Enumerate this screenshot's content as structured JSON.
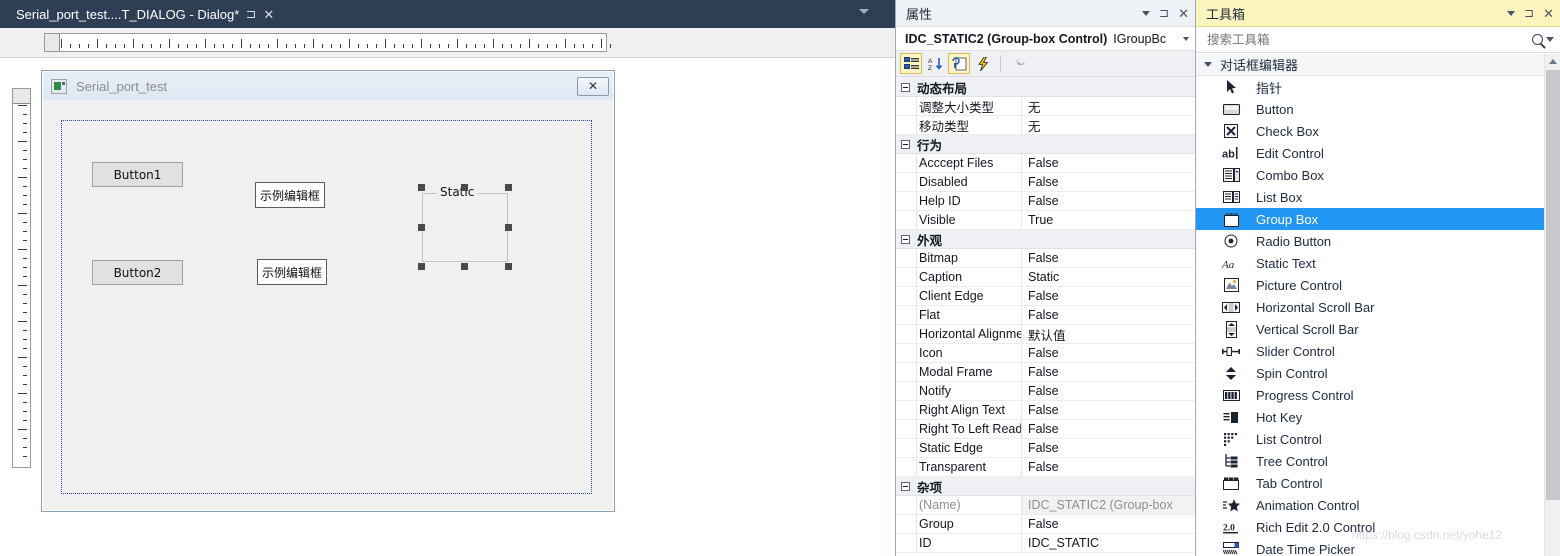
{
  "editor": {
    "tab": {
      "title": "Serial_port_test....T_DIALOG - Dialog*",
      "pin_icon": "⊐",
      "close_icon": "✕",
      "menu_icon": "chevron-down-icon"
    },
    "dialog": {
      "caption": "Serial_port_test",
      "close_label": "✕",
      "controls": [
        {
          "kind": "button",
          "label": "Button1"
        },
        {
          "kind": "button",
          "label": "Button2"
        },
        {
          "kind": "edit",
          "label": "示例编辑框"
        },
        {
          "kind": "edit",
          "label": "示例编辑框"
        },
        {
          "kind": "groupbox",
          "label": "Static",
          "selected": true
        }
      ]
    }
  },
  "properties": {
    "panel_title": "属性",
    "object_name": "IDC_STATIC2 (Group-box Control)",
    "object_type": "IGroupBc",
    "toolbar": [
      {
        "name": "categorized-view",
        "active": true
      },
      {
        "name": "alphabetical-sort",
        "active": false
      },
      {
        "name": "property-pages",
        "active": true
      },
      {
        "name": "events",
        "active": false
      },
      {
        "name": "messages",
        "active": false
      }
    ],
    "groups": [
      {
        "label": "动态布局",
        "rows": [
          {
            "name": "调整大小类型",
            "value": "无"
          },
          {
            "name": "移动类型",
            "value": "无"
          }
        ]
      },
      {
        "label": "行为",
        "rows": [
          {
            "name": "Acccept Files",
            "value": "False"
          },
          {
            "name": "Disabled",
            "value": "False"
          },
          {
            "name": "Help ID",
            "value": "False"
          },
          {
            "name": "Visible",
            "value": "True"
          }
        ]
      },
      {
        "label": "外观",
        "rows": [
          {
            "name": "Bitmap",
            "value": "False"
          },
          {
            "name": "Caption",
            "value": "Static"
          },
          {
            "name": "Client Edge",
            "value": "False"
          },
          {
            "name": "Flat",
            "value": "False"
          },
          {
            "name": "Horizontal Alignment",
            "value": "默认值"
          },
          {
            "name": "Icon",
            "value": "False"
          },
          {
            "name": "Modal Frame",
            "value": "False"
          },
          {
            "name": "Notify",
            "value": "False"
          },
          {
            "name": "Right Align Text",
            "value": "False"
          },
          {
            "name": "Right To Left Reading",
            "value": "False"
          },
          {
            "name": "Static Edge",
            "value": "False"
          },
          {
            "name": "Transparent",
            "value": "False"
          }
        ]
      },
      {
        "label": "杂项",
        "rows": [
          {
            "name": "(Name)",
            "value": "IDC_STATIC2 (Group-box",
            "readonly": true
          },
          {
            "name": "Group",
            "value": "False"
          },
          {
            "name": "ID",
            "value": "IDC_STATIC"
          }
        ]
      }
    ]
  },
  "toolbox": {
    "panel_title": "工具箱",
    "search_placeholder": "搜索工具箱",
    "search_value": "",
    "group_label": "对话框编辑器",
    "items": [
      {
        "label": "指针",
        "icon": "pointer-icon",
        "selected": false
      },
      {
        "label": "Button",
        "icon": "button-icon",
        "selected": false
      },
      {
        "label": "Check Box",
        "icon": "check-box-icon",
        "selected": false
      },
      {
        "label": "Edit Control",
        "icon": "edit-control-icon",
        "selected": false
      },
      {
        "label": "Combo Box",
        "icon": "combo-box-icon",
        "selected": false
      },
      {
        "label": "List Box",
        "icon": "list-box-icon",
        "selected": false
      },
      {
        "label": "Group Box",
        "icon": "group-box-icon",
        "selected": true
      },
      {
        "label": "Radio Button",
        "icon": "radio-button-icon",
        "selected": false
      },
      {
        "label": "Static Text",
        "icon": "static-text-icon",
        "selected": false
      },
      {
        "label": "Picture Control",
        "icon": "picture-control-icon",
        "selected": false
      },
      {
        "label": "Horizontal Scroll Bar",
        "icon": "horizontal-scroll-bar-icon",
        "selected": false
      },
      {
        "label": "Vertical Scroll Bar",
        "icon": "vertical-scroll-bar-icon",
        "selected": false
      },
      {
        "label": "Slider Control",
        "icon": "slider-control-icon",
        "selected": false
      },
      {
        "label": "Spin Control",
        "icon": "spin-control-icon",
        "selected": false
      },
      {
        "label": "Progress Control",
        "icon": "progress-control-icon",
        "selected": false
      },
      {
        "label": "Hot Key",
        "icon": "hot-key-icon",
        "selected": false
      },
      {
        "label": "List Control",
        "icon": "list-control-icon",
        "selected": false
      },
      {
        "label": "Tree Control",
        "icon": "tree-control-icon",
        "selected": false
      },
      {
        "label": "Tab Control",
        "icon": "tab-control-icon",
        "selected": false
      },
      {
        "label": "Animation Control",
        "icon": "animation-control-icon",
        "selected": false
      },
      {
        "label": "Rich Edit 2.0 Control",
        "icon": "rich-edit-icon",
        "selected": false
      },
      {
        "label": "Date Time Picker",
        "icon": "date-time-picker-icon",
        "selected": false
      }
    ]
  },
  "watermark": {
    "text": "https://blog.csdn.net/yohe12"
  },
  "colors": {
    "tab_bar": "#2d3e55",
    "toolbox_title": "#fcf3bd",
    "selection": "#2196f3",
    "guide": "#2a3fb8"
  }
}
